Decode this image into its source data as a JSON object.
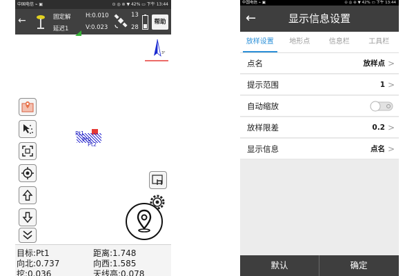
{
  "left": {
    "status": {
      "left": "中国电信 ⌁ ▣",
      "right": "⊙ ◎ ⊚ ▼ 42% ▭ 下午 13:44"
    },
    "gps": {
      "fix_label": "固定解",
      "epoch_label": "延迟1",
      "h_precision": "H:0.010",
      "v_precision": "V:0.023",
      "sats_top": "13",
      "sats_bottom": "28",
      "help_label": "帮助"
    },
    "map": {
      "compass_label": "3°",
      "pt_labels": [
        "Pt1",
        "Pt0",
        "Pt2"
      ]
    },
    "info": {
      "target": "目标:Pt1",
      "distance": "距离:1.748",
      "north": "向北:0.737",
      "west": "向西:1.585",
      "dig": "挖:0.036",
      "antenna": "天线高:0.078"
    },
    "colors": {
      "accent_red": "#e53935",
      "marker_orange": "#e8734a"
    }
  },
  "right": {
    "status": {
      "left": "中国电信 ⌁ ▣",
      "right": "⊙ ◎ ⊚ ▼ 42% ▭ 下午 13:44"
    },
    "title": "显示信息设置",
    "tabs": [
      "放样设置",
      "地形点",
      "信息栏",
      "工具栏"
    ],
    "rows": [
      {
        "label": "点名",
        "value": "放样点"
      },
      {
        "label": "提示范围",
        "value": "1"
      },
      {
        "label": "自动缩放",
        "value": ""
      },
      {
        "label": "放样限差",
        "value": "0.2"
      },
      {
        "label": "显示信息",
        "value": "点名"
      }
    ],
    "footer": {
      "default_label": "默认",
      "confirm_label": "确定"
    },
    "colors": {
      "accent_blue": "#2a8fd8",
      "title_bg": "#3e3e3e"
    }
  }
}
